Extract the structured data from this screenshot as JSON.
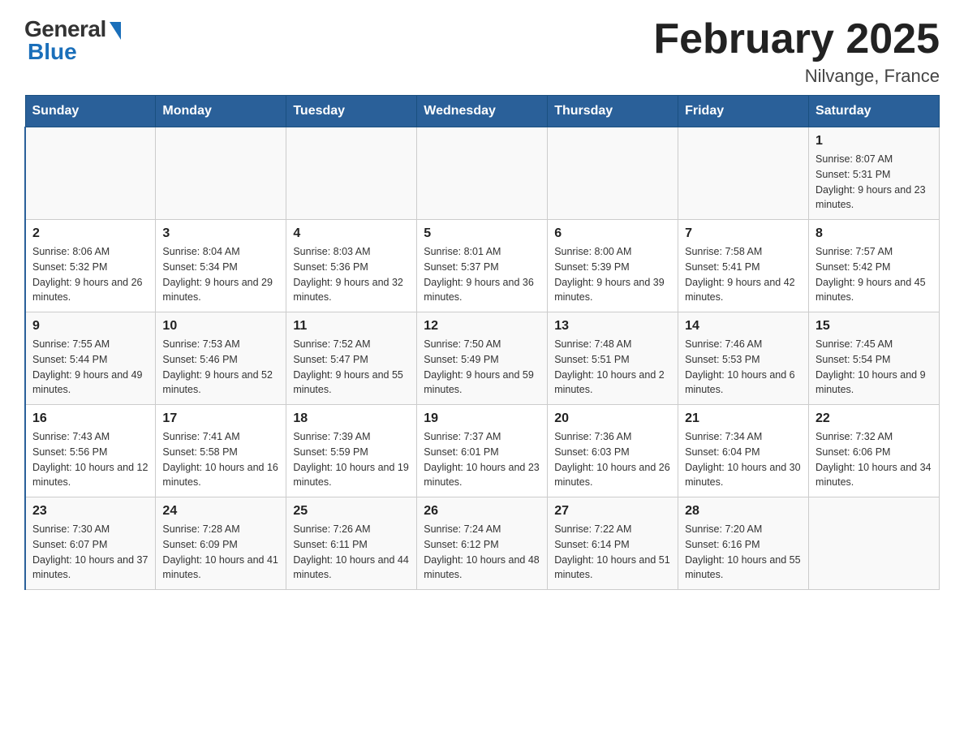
{
  "header": {
    "logo_general": "General",
    "logo_blue": "Blue",
    "month_title": "February 2025",
    "location": "Nilvange, France"
  },
  "days_of_week": [
    "Sunday",
    "Monday",
    "Tuesday",
    "Wednesday",
    "Thursday",
    "Friday",
    "Saturday"
  ],
  "weeks": [
    [
      {
        "day": "",
        "info": ""
      },
      {
        "day": "",
        "info": ""
      },
      {
        "day": "",
        "info": ""
      },
      {
        "day": "",
        "info": ""
      },
      {
        "day": "",
        "info": ""
      },
      {
        "day": "",
        "info": ""
      },
      {
        "day": "1",
        "info": "Sunrise: 8:07 AM\nSunset: 5:31 PM\nDaylight: 9 hours and 23 minutes."
      }
    ],
    [
      {
        "day": "2",
        "info": "Sunrise: 8:06 AM\nSunset: 5:32 PM\nDaylight: 9 hours and 26 minutes."
      },
      {
        "day": "3",
        "info": "Sunrise: 8:04 AM\nSunset: 5:34 PM\nDaylight: 9 hours and 29 minutes."
      },
      {
        "day": "4",
        "info": "Sunrise: 8:03 AM\nSunset: 5:36 PM\nDaylight: 9 hours and 32 minutes."
      },
      {
        "day": "5",
        "info": "Sunrise: 8:01 AM\nSunset: 5:37 PM\nDaylight: 9 hours and 36 minutes."
      },
      {
        "day": "6",
        "info": "Sunrise: 8:00 AM\nSunset: 5:39 PM\nDaylight: 9 hours and 39 minutes."
      },
      {
        "day": "7",
        "info": "Sunrise: 7:58 AM\nSunset: 5:41 PM\nDaylight: 9 hours and 42 minutes."
      },
      {
        "day": "8",
        "info": "Sunrise: 7:57 AM\nSunset: 5:42 PM\nDaylight: 9 hours and 45 minutes."
      }
    ],
    [
      {
        "day": "9",
        "info": "Sunrise: 7:55 AM\nSunset: 5:44 PM\nDaylight: 9 hours and 49 minutes."
      },
      {
        "day": "10",
        "info": "Sunrise: 7:53 AM\nSunset: 5:46 PM\nDaylight: 9 hours and 52 minutes."
      },
      {
        "day": "11",
        "info": "Sunrise: 7:52 AM\nSunset: 5:47 PM\nDaylight: 9 hours and 55 minutes."
      },
      {
        "day": "12",
        "info": "Sunrise: 7:50 AM\nSunset: 5:49 PM\nDaylight: 9 hours and 59 minutes."
      },
      {
        "day": "13",
        "info": "Sunrise: 7:48 AM\nSunset: 5:51 PM\nDaylight: 10 hours and 2 minutes."
      },
      {
        "day": "14",
        "info": "Sunrise: 7:46 AM\nSunset: 5:53 PM\nDaylight: 10 hours and 6 minutes."
      },
      {
        "day": "15",
        "info": "Sunrise: 7:45 AM\nSunset: 5:54 PM\nDaylight: 10 hours and 9 minutes."
      }
    ],
    [
      {
        "day": "16",
        "info": "Sunrise: 7:43 AM\nSunset: 5:56 PM\nDaylight: 10 hours and 12 minutes."
      },
      {
        "day": "17",
        "info": "Sunrise: 7:41 AM\nSunset: 5:58 PM\nDaylight: 10 hours and 16 minutes."
      },
      {
        "day": "18",
        "info": "Sunrise: 7:39 AM\nSunset: 5:59 PM\nDaylight: 10 hours and 19 minutes."
      },
      {
        "day": "19",
        "info": "Sunrise: 7:37 AM\nSunset: 6:01 PM\nDaylight: 10 hours and 23 minutes."
      },
      {
        "day": "20",
        "info": "Sunrise: 7:36 AM\nSunset: 6:03 PM\nDaylight: 10 hours and 26 minutes."
      },
      {
        "day": "21",
        "info": "Sunrise: 7:34 AM\nSunset: 6:04 PM\nDaylight: 10 hours and 30 minutes."
      },
      {
        "day": "22",
        "info": "Sunrise: 7:32 AM\nSunset: 6:06 PM\nDaylight: 10 hours and 34 minutes."
      }
    ],
    [
      {
        "day": "23",
        "info": "Sunrise: 7:30 AM\nSunset: 6:07 PM\nDaylight: 10 hours and 37 minutes."
      },
      {
        "day": "24",
        "info": "Sunrise: 7:28 AM\nSunset: 6:09 PM\nDaylight: 10 hours and 41 minutes."
      },
      {
        "day": "25",
        "info": "Sunrise: 7:26 AM\nSunset: 6:11 PM\nDaylight: 10 hours and 44 minutes."
      },
      {
        "day": "26",
        "info": "Sunrise: 7:24 AM\nSunset: 6:12 PM\nDaylight: 10 hours and 48 minutes."
      },
      {
        "day": "27",
        "info": "Sunrise: 7:22 AM\nSunset: 6:14 PM\nDaylight: 10 hours and 51 minutes."
      },
      {
        "day": "28",
        "info": "Sunrise: 7:20 AM\nSunset: 6:16 PM\nDaylight: 10 hours and 55 minutes."
      },
      {
        "day": "",
        "info": ""
      }
    ]
  ]
}
